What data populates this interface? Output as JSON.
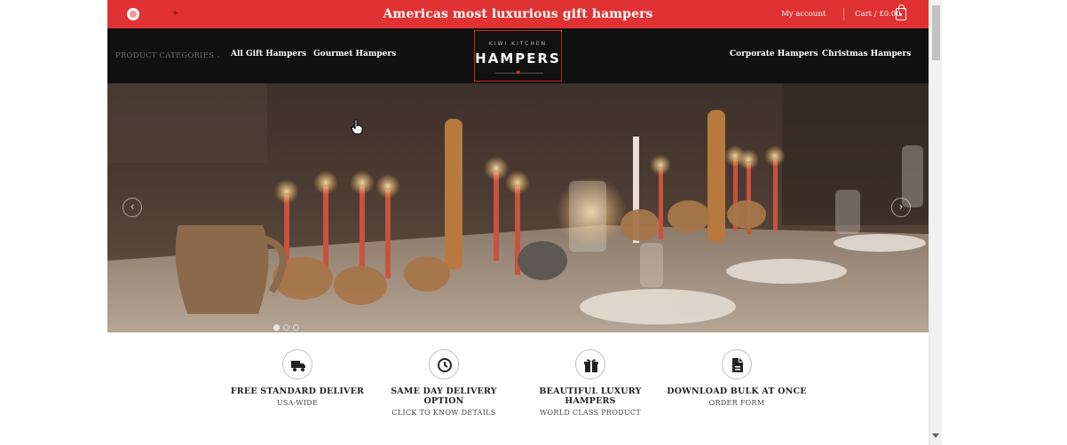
{
  "topbar": {
    "promo": "Americas most luxurious gift hampers",
    "my_account": "My account",
    "cart": "Cart / £0.00",
    "brand_color": "#e03232"
  },
  "nav": {
    "categories": "PRODUCT CATEGORIES",
    "links": [
      "All Gift Hampers",
      "Gourmet Hampers",
      "Corporate Hampers",
      "Christmas Hampers"
    ],
    "logo": {
      "line1": "KIWI KITCHEN",
      "line2": "HAMPERS"
    }
  },
  "hero": {
    "slides": 3,
    "active_slide": 1
  },
  "features": [
    {
      "icon": "truck-icon",
      "title": "FREE STANDARD DELIVER",
      "sub": "USA-WIDE"
    },
    {
      "icon": "clock-icon",
      "title": "SAME DAY DELIVERY OPTION",
      "sub": "CLICK TO KNOW DETAILS"
    },
    {
      "icon": "gift-icon",
      "title": "BEAUTIFUL LUXURY HAMPERS",
      "sub": "WORLD CLASS PRODUCT"
    },
    {
      "icon": "document-icon",
      "title": "DOWNLOAD BULK AT ONCE",
      "sub": "ORDER FORM"
    }
  ]
}
